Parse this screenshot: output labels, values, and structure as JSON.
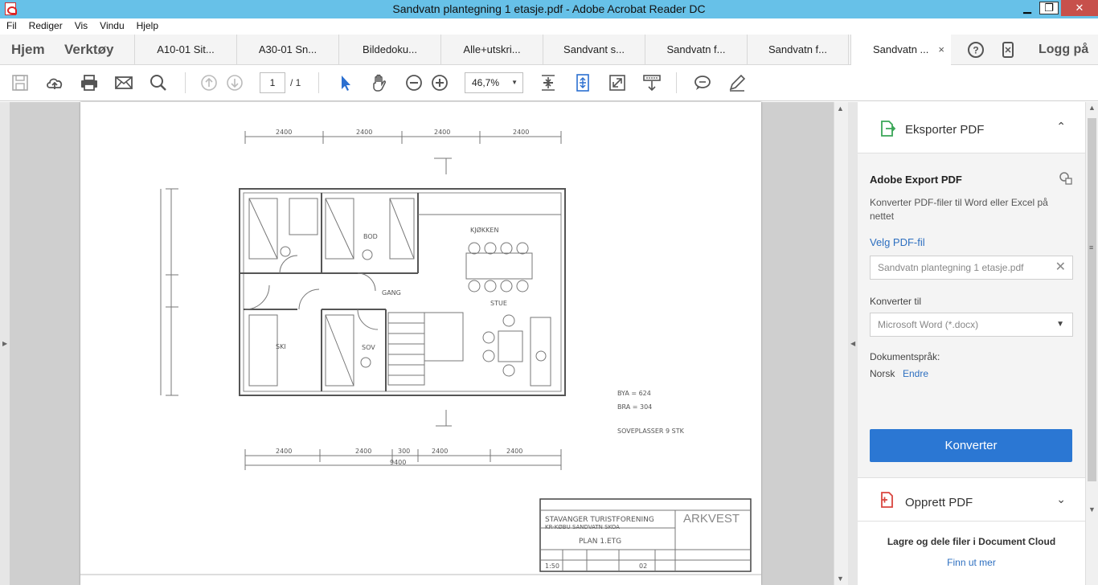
{
  "window": {
    "title": "Sandvatn plantegning 1 etasje.pdf - Adobe Acrobat Reader DC",
    "min": "▁",
    "max": "❐",
    "close": "✕"
  },
  "menu": [
    "Fil",
    "Rediger",
    "Vis",
    "Vindu",
    "Hjelp"
  ],
  "nav": {
    "home": "Hjem",
    "tools": "Verktøy",
    "login": "Logg på"
  },
  "tabs": [
    {
      "label": "A10-01 Sit..."
    },
    {
      "label": "A30-01 Sn..."
    },
    {
      "label": "Bildedoku..."
    },
    {
      "label": "Alle+utskri..."
    },
    {
      "label": "Sandvant s..."
    },
    {
      "label": "Sandvatn f..."
    },
    {
      "label": "Sandvatn f..."
    },
    {
      "label": "Sandvatn ...",
      "active": true,
      "close": "×"
    }
  ],
  "toolbar": {
    "page_current": "1",
    "page_total": "/ 1",
    "zoom": "46,7%",
    "zoom_caret": "▼"
  },
  "pane": {
    "export_header": "Eksporter PDF",
    "export_chevron": "⌃",
    "export_title": "Adobe Export PDF",
    "export_desc": "Konverter PDF-filer til Word eller Excel på nettet",
    "choose_file": "Velg PDF-fil",
    "file_value": "Sandvatn plantegning 1 etasje.pdf",
    "clear": "✕",
    "convert_to_label": "Konverter til",
    "convert_to_value": "Microsoft Word (*.docx)",
    "select_caret": "▼",
    "language_label": "Dokumentspråk:",
    "language_value": "Norsk",
    "language_edit": "Endre",
    "convert_button": "Konverter",
    "create_header": "Opprett PDF",
    "create_chevron": "⌄",
    "cloud_title": "Lagre og dele filer i Document Cloud",
    "cloud_link": "Finn ut mer"
  },
  "drawing": {
    "title_block": {
      "company": "ARKVEST",
      "project_line1": "STAVANGER TURISTFORENING",
      "project_line2": "KR-KØBU SANDVATN SKOA",
      "drawing_title": "PLAN 1.ETG",
      "scale": "1:50",
      "sheet": "02"
    },
    "rooms": [
      "KJØKKEN",
      "STUE",
      "BOD",
      "SOV",
      "GANG",
      "SKI"
    ],
    "notes": [
      "BYA = 624",
      "BRA = 304",
      "SOVEPLASSER 9 STK"
    ],
    "dims_top": [
      "2400",
      "2400",
      "2400",
      "2400"
    ],
    "dims_bottom": [
      "2400",
      "2400",
      "300",
      "2400",
      "2400"
    ],
    "dim_total": "9400"
  },
  "colors": {
    "accent": "#2b77d3",
    "titlebar": "#67c1e8",
    "link": "#2d6fc0"
  }
}
